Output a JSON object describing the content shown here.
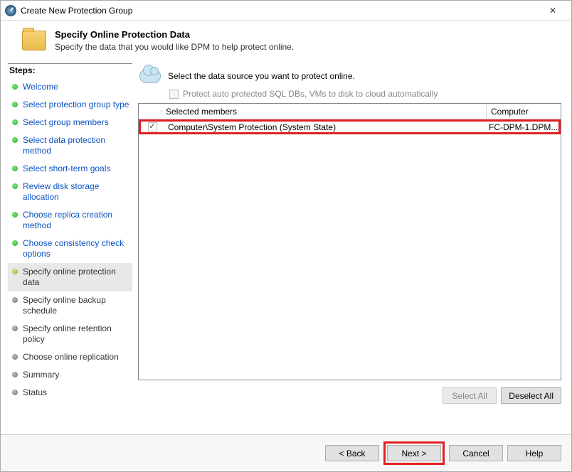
{
  "window": {
    "title": "Create New Protection Group",
    "close": "✕"
  },
  "header": {
    "title": "Specify Online Protection Data",
    "subtitle": "Specify the data that you would like DPM to help protect online."
  },
  "steps_label": "Steps:",
  "steps": [
    {
      "label": "Welcome",
      "status": "done",
      "link": true
    },
    {
      "label": "Select protection group type",
      "status": "done",
      "link": true
    },
    {
      "label": "Select group members",
      "status": "done",
      "link": true
    },
    {
      "label": "Select data protection method",
      "status": "done",
      "link": true
    },
    {
      "label": "Select short-term goals",
      "status": "done",
      "link": true
    },
    {
      "label": "Review disk storage allocation",
      "status": "done",
      "link": true
    },
    {
      "label": "Choose replica creation method",
      "status": "done",
      "link": true
    },
    {
      "label": "Choose consistency check options",
      "status": "done",
      "link": true
    },
    {
      "label": "Specify online protection data",
      "status": "current",
      "link": false
    },
    {
      "label": "Specify online backup schedule",
      "status": "pending",
      "link": false
    },
    {
      "label": "Specify online retention policy",
      "status": "pending",
      "link": false
    },
    {
      "label": "Choose online replication",
      "status": "pending",
      "link": false
    },
    {
      "label": "Summary",
      "status": "pending",
      "link": false
    },
    {
      "label": "Status",
      "status": "pending",
      "link": false
    }
  ],
  "main": {
    "instruction": "Select the data source you want to protect online.",
    "auto_checkbox_label": "Protect auto protected SQL DBs, VMs to disk to cloud automatically",
    "columns": {
      "member": "Selected members",
      "computer": "Computer"
    },
    "rows": [
      {
        "checked": true,
        "member": "Computer\\System Protection (System State)",
        "computer": "FC-DPM-1.DPM..."
      }
    ],
    "select_all": "Select All",
    "deselect_all": "Deselect All"
  },
  "footer": {
    "back": "< Back",
    "next": "Next >",
    "cancel": "Cancel",
    "help": "Help"
  }
}
